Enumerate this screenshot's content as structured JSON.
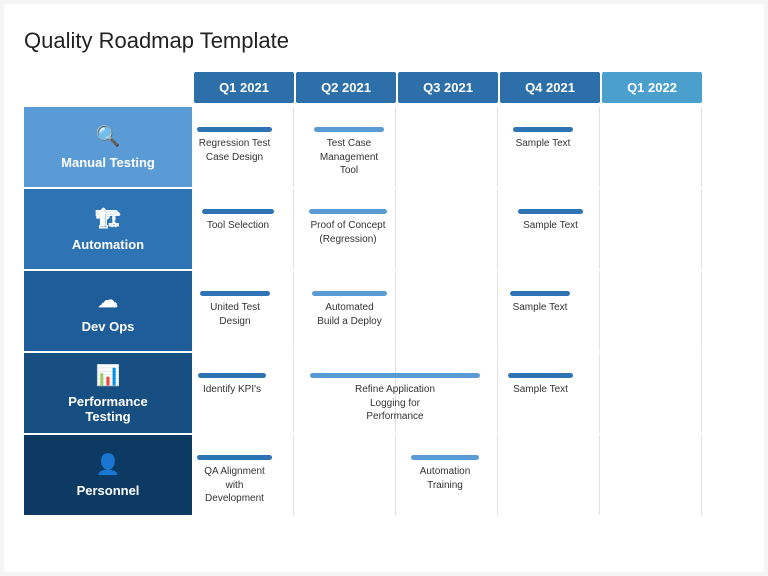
{
  "title": "Quality Roadmap Template",
  "quarters": [
    {
      "label": "Q1 2021",
      "light": false
    },
    {
      "label": "Q2 2021",
      "light": false
    },
    {
      "label": "Q3 2021",
      "light": false
    },
    {
      "label": "Q4 2021",
      "light": false
    },
    {
      "label": "Q1 2022",
      "light": true
    }
  ],
  "rows": [
    {
      "id": "manual",
      "icon": "🔍",
      "label": "Manual Testing",
      "tasks": [
        {
          "col": 0,
          "offset": 5,
          "width": 75,
          "text": "Regression Test\nCase Design",
          "barClass": ""
        },
        {
          "col": 1,
          "offset": 20,
          "width": 70,
          "text": "Test Case\nManagement Tool",
          "barClass": "light"
        },
        {
          "col": 3,
          "offset": 15,
          "width": 60,
          "text": "Sample Text",
          "barClass": ""
        }
      ]
    },
    {
      "id": "automation",
      "icon": "🏗",
      "label": "Automation",
      "tasks": [
        {
          "col": 0,
          "offset": 10,
          "width": 72,
          "text": "Tool Selection",
          "barClass": ""
        },
        {
          "col": 1,
          "offset": 15,
          "width": 78,
          "text": "Proof of Concept\n(Regression)",
          "barClass": "light"
        },
        {
          "col": 3,
          "offset": 20,
          "width": 65,
          "text": "Sample Text",
          "barClass": ""
        }
      ]
    },
    {
      "id": "devops",
      "icon": "☁",
      "label": "Dev Ops",
      "tasks": [
        {
          "col": 0,
          "offset": 8,
          "width": 70,
          "text": "United Test\nDesign",
          "barClass": ""
        },
        {
          "col": 1,
          "offset": 18,
          "width": 75,
          "text": "Automated\nBuild a Deploy",
          "barClass": "light"
        },
        {
          "col": 3,
          "offset": 12,
          "width": 60,
          "text": "Sample Text",
          "barClass": ""
        }
      ]
    },
    {
      "id": "performance",
      "icon": "📊",
      "label": "Performance\nTesting",
      "tasks": [
        {
          "col": 0,
          "offset": 6,
          "width": 68,
          "text": "Identify KPI's",
          "barClass": ""
        },
        {
          "col": 1,
          "offset": 16,
          "width": 170,
          "text": "Refine Application Logging for\nPerformance",
          "barClass": "light"
        },
        {
          "col": 3,
          "offset": 10,
          "width": 65,
          "text": "Sample Text",
          "barClass": ""
        }
      ]
    },
    {
      "id": "personnel",
      "icon": "👤",
      "label": "Personnel",
      "tasks": [
        {
          "col": 0,
          "offset": 5,
          "width": 75,
          "text": "QA Alignment with\nDevelopment",
          "barClass": ""
        },
        {
          "col": 2,
          "offset": 15,
          "width": 68,
          "text": "Automation\nTraining",
          "barClass": "light"
        }
      ]
    }
  ],
  "row_classes": [
    "row-manual",
    "row-automation",
    "row-devops",
    "row-performance",
    "row-personnel"
  ]
}
